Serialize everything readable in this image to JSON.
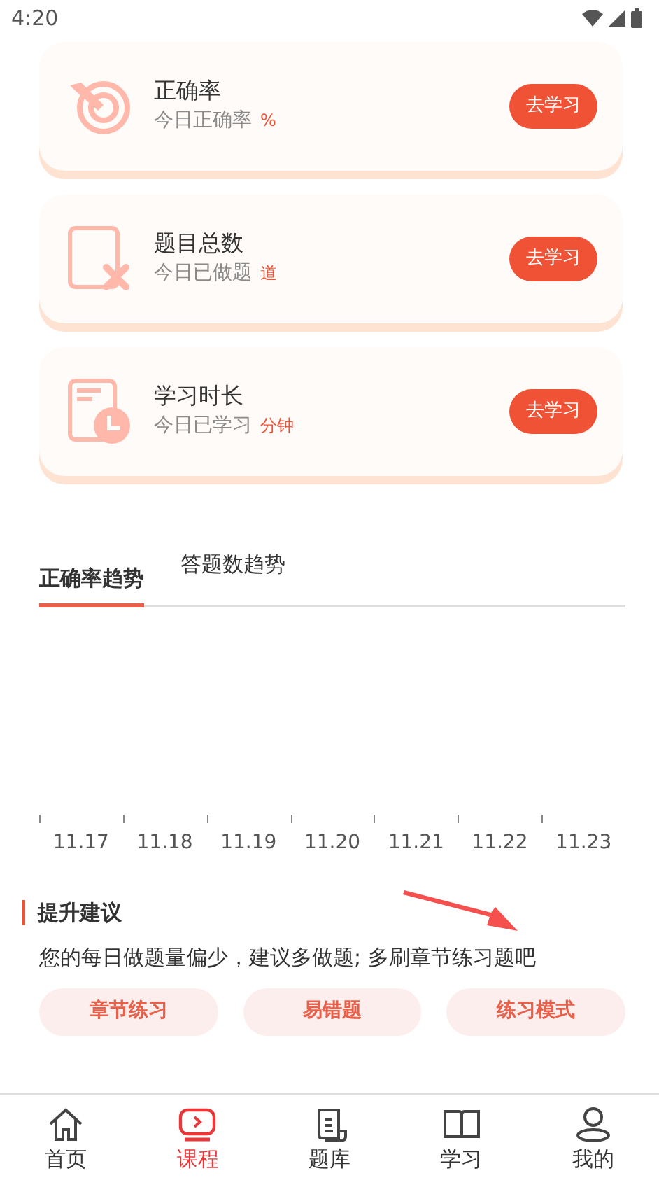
{
  "status_bar": {
    "time": "4:20"
  },
  "stats": [
    {
      "kind": "target",
      "title": "正确率",
      "subtitle": "今日正确率",
      "unit": "%",
      "button": "去学习"
    },
    {
      "kind": "questions",
      "title": "题目总数",
      "subtitle": "今日已做题",
      "unit": "道",
      "button": "去学习"
    },
    {
      "kind": "time",
      "title": "学习时长",
      "subtitle": "今日已学习",
      "unit": "分钟",
      "button": "去学习"
    }
  ],
  "trend_tabs": [
    {
      "label": "正确率趋势",
      "selected": true
    },
    {
      "label": "答题数趋势",
      "selected": false
    }
  ],
  "chart_axis": [
    "11.17",
    "11.18",
    "11.19",
    "11.20",
    "11.21",
    "11.22",
    "11.23"
  ],
  "suggestion": {
    "title": "提升建议",
    "text": "您的每日做题量偏少，建议多做题; 多刷章节练习题吧",
    "buttons": [
      "章节练习",
      "易错题",
      "练习模式"
    ]
  },
  "bottom_nav": [
    {
      "kind": "home",
      "label": "首页",
      "selected": false
    },
    {
      "kind": "course",
      "label": "课程",
      "selected": true
    },
    {
      "kind": "bank",
      "label": "题库",
      "selected": false
    },
    {
      "kind": "book",
      "label": "学习",
      "selected": false
    },
    {
      "kind": "user",
      "label": "我的",
      "selected": false
    }
  ]
}
